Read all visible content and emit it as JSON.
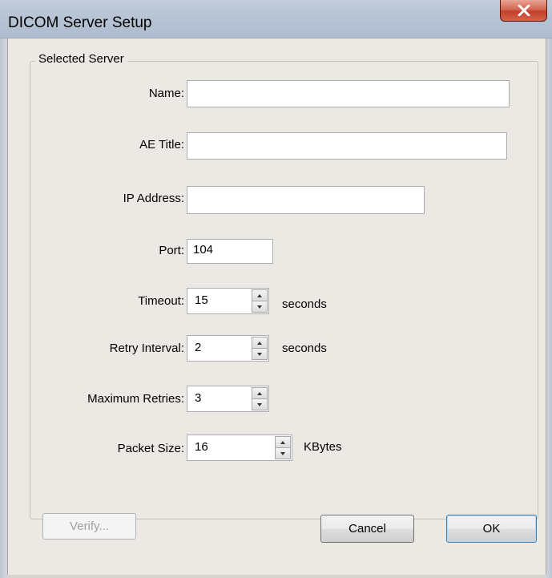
{
  "window": {
    "title": "DICOM Server Setup"
  },
  "group": {
    "label": "Selected Server"
  },
  "fields": {
    "name": {
      "label": "Name:",
      "value": ""
    },
    "ae_title": {
      "label": "AE Title:",
      "value": ""
    },
    "ip_address": {
      "label": "IP Address:",
      "value": ""
    },
    "port": {
      "label": "Port:",
      "value": "104"
    },
    "timeout": {
      "label": "Timeout:",
      "value": "15",
      "unit": "seconds"
    },
    "retry_interval": {
      "label": "Retry Interval:",
      "value": "2",
      "unit": "seconds"
    },
    "max_retries": {
      "label": "Maximum Retries:",
      "value": "3"
    },
    "packet_size": {
      "label": "Packet Size:",
      "value": "16",
      "unit": "KBytes"
    }
  },
  "buttons": {
    "verify": "Verify...",
    "cancel": "Cancel",
    "ok": "OK"
  }
}
